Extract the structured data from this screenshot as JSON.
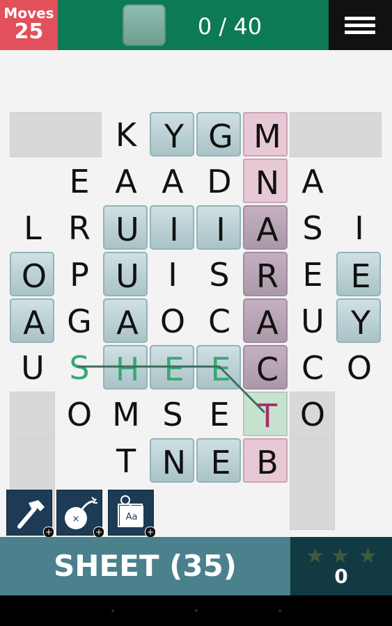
{
  "header": {
    "moves_label": "Moves",
    "moves_value": "25",
    "score": "0 / 40"
  },
  "board": {
    "rows": 8,
    "cols": 8,
    "cells": [
      [
        "",
        "",
        "K",
        "Y",
        "G",
        "M",
        "",
        ""
      ],
      [
        "",
        "E",
        "A",
        "A",
        "D",
        "N",
        "A",
        ""
      ],
      [
        "L",
        "R",
        "U",
        "I",
        "I",
        "A",
        "S",
        "I"
      ],
      [
        "O",
        "P",
        "U",
        "I",
        "S",
        "R",
        "E",
        "E"
      ],
      [
        "A",
        "G",
        "A",
        "O",
        "C",
        "A",
        "U",
        "Y"
      ],
      [
        "U",
        "S",
        "H",
        "E",
        "E",
        "C",
        "C",
        "O"
      ],
      [
        "",
        "O",
        "M",
        "S",
        "E",
        "T",
        "O",
        ""
      ],
      [
        "",
        "",
        "T",
        "N",
        "E",
        "B",
        "",
        ""
      ]
    ]
  },
  "tools": [
    {
      "icon": "hammer-icon",
      "badge": "+"
    },
    {
      "icon": "bomb-icon",
      "badge": "+"
    },
    {
      "icon": "dictionary-icon",
      "badge": "+",
      "label": "Aa"
    }
  ],
  "word": {
    "text": "SHEET (35)"
  },
  "stars": {
    "count": "0"
  },
  "colors": {
    "header_green": "#0c7a55",
    "moves_red": "#e1505b",
    "selection_green": "#3aa876",
    "column_pink": "#e7c9d5",
    "word_bar": "#4b808d",
    "star_panel": "#123a43"
  }
}
